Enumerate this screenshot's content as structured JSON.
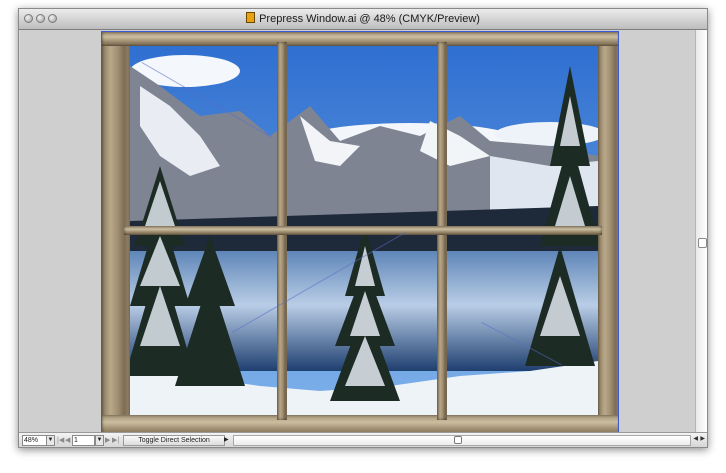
{
  "window": {
    "title": "Prepress Window.ai @ 48% (CMYK/Preview)",
    "document_icon": "illustrator-document-icon"
  },
  "titlebar": {
    "buttons": [
      "close-button",
      "minimize-button",
      "zoom-button"
    ]
  },
  "canvas": {
    "artwork": "snowy-mountain-lake-through-wooden-window-frame"
  },
  "statusbar": {
    "zoom_value": "48%",
    "page_value": "1",
    "status_text": "Toggle Direct Selection"
  },
  "colors": {
    "selection_guide": "#3b5bd6",
    "canvas_bg": "#cfcfcf",
    "frame_wood": "#a39174"
  }
}
